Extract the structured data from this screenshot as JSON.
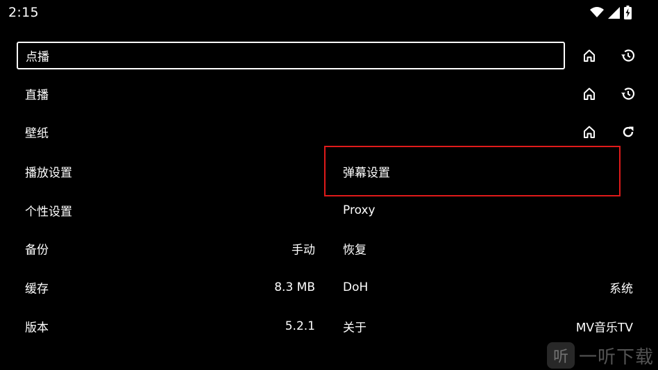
{
  "status_bar": {
    "time": "2:15",
    "icons": [
      "wifi-icon",
      "signal-icon",
      "battery-charging-icon"
    ]
  },
  "top_rows": [
    {
      "label": "点播",
      "focused": true,
      "actions": [
        "home-icon",
        "history-icon"
      ]
    },
    {
      "label": "直播",
      "focused": false,
      "actions": [
        "home-icon",
        "history-icon"
      ]
    },
    {
      "label": "壁纸",
      "focused": false,
      "actions": [
        "home-icon",
        "refresh-icon"
      ]
    }
  ],
  "settings_left": [
    {
      "label": "播放设置",
      "value": ""
    },
    {
      "label": "个性设置",
      "value": ""
    },
    {
      "label": "备份",
      "value": "手动"
    },
    {
      "label": "缓存",
      "value": "8.3 MB"
    },
    {
      "label": "版本",
      "value": "5.2.1"
    }
  ],
  "settings_right": [
    {
      "label": "弹幕设置",
      "value": ""
    },
    {
      "label": "Proxy",
      "value": ""
    },
    {
      "label": "恢复",
      "value": ""
    },
    {
      "label": "DoH",
      "value": "系统"
    },
    {
      "label": "关于",
      "value": "MV音乐TV"
    }
  ],
  "highlight": {
    "target": "弹幕设置",
    "color": "#e01a1a"
  },
  "watermark": {
    "logo_char": "听",
    "text": "一听下载"
  }
}
